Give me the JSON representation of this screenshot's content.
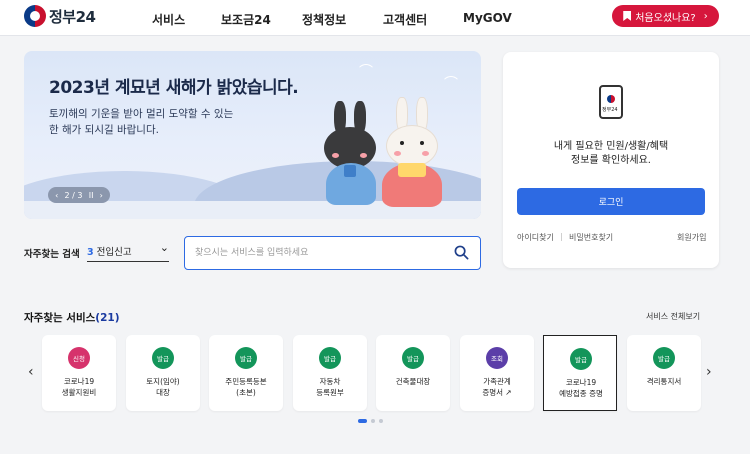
{
  "header": {
    "logo_text": "정부24",
    "nav": [
      "서비스",
      "보조금24",
      "정책정보",
      "고객센터",
      "MyGOV"
    ],
    "first_visit_label": "처음오셨나요?",
    "first_visit_arrow": "›"
  },
  "banner": {
    "title": "2023년 계묘년 새해가 밝았습니다.",
    "sub_line1": "토끼해의 기운을 받아 멀리 도약할 수 있는",
    "sub_line2": "한 해가 되시길 바랍니다.",
    "pager": {
      "prev": "‹",
      "current": "2 / 3",
      "pause": "II",
      "next": "›"
    }
  },
  "login": {
    "phone_label": "정부24",
    "message_line1": "내게 필요한 민원/생활/혜택",
    "message_line2": "정보를 확인하세요.",
    "button": "로그인",
    "find_id": "아이디찾기",
    "find_pw": "비밀번호찾기",
    "signup": "회원가입",
    "separator": "|"
  },
  "frequent_search": {
    "label": "자주찾는 검색",
    "selected_num": "3",
    "selected_text": "전입신고",
    "chevron": "⌄"
  },
  "search": {
    "placeholder": "찾으시는 서비스를 입력하세요"
  },
  "services": {
    "title": "자주찾는 서비스",
    "count": "(21)",
    "all_link": "서비스 전체보기",
    "prev": "‹",
    "next": "›",
    "items": [
      {
        "badge": "신청",
        "line1": "코로나19",
        "line2": "생활지원비",
        "color": "#d6336c"
      },
      {
        "badge": "발급",
        "line1": "토지(임야)",
        "line2": "대장",
        "color": "#13955a"
      },
      {
        "badge": "발급",
        "line1": "주민등록등본",
        "line2": "(초본)",
        "color": "#13955a"
      },
      {
        "badge": "발급",
        "line1": "자동차",
        "line2": "등록원부",
        "color": "#13955a"
      },
      {
        "badge": "발급",
        "line1": "건축물대장",
        "line2": "",
        "color": "#13955a"
      },
      {
        "badge": "조회",
        "line1": "가족관계",
        "line2": "증명서 ↗",
        "color": "#5b3ea8"
      },
      {
        "badge": "발급",
        "line1": "코로나19",
        "line2": "예방접종 증명",
        "color": "#13955a"
      },
      {
        "badge": "발급",
        "line1": "격리통지서",
        "line2": "",
        "color": "#13955a"
      }
    ]
  },
  "colors": {
    "accent": "#2d6ae3",
    "brand_red": "#d6163c"
  }
}
